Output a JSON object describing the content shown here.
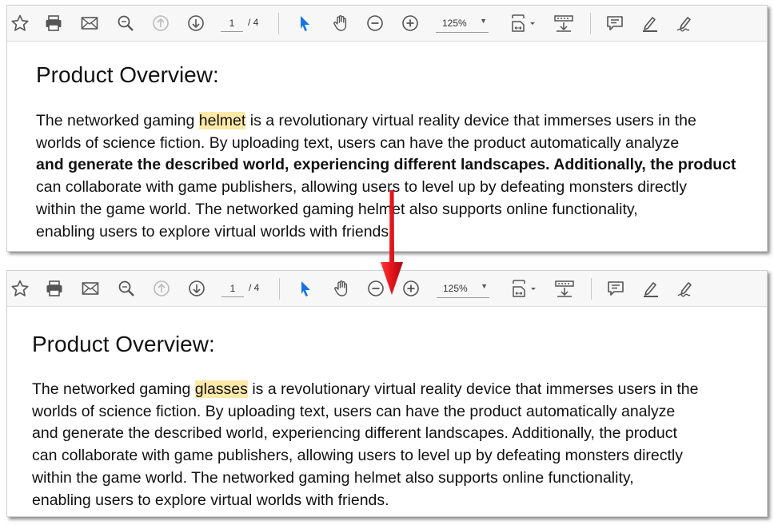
{
  "toolbar": {
    "page_current": "1",
    "page_total": "/ 4",
    "zoom_value": "125%",
    "icons": [
      "star-icon",
      "print-icon",
      "mail-icon",
      "zoom-search-icon",
      "arrow-up-icon",
      "arrow-down-icon",
      "select-cursor-icon",
      "hand-icon",
      "zoom-out-icon",
      "zoom-in-icon",
      "fit-page-icon",
      "scroll-mode-icon",
      "comment-icon",
      "highlight-pen-icon",
      "sign-icon"
    ],
    "accent_color": "#1473e6"
  },
  "document_before": {
    "heading": "Product Overview:",
    "line1_pre": "The networked gaming ",
    "line1_highlight": "helmet",
    "line1_post": " is a revolutionary virtual reality device that immerses users in the",
    "line2": "worlds of science fiction. By uploading text, users can have the product automatically analyze",
    "line3": "and generate the described world, experiencing different landscapes. Additionally, the product",
    "line4": "can collaborate with game publishers, allowing users to level up by defeating monsters directly",
    "line5": "within the game world. The networked gaming helmet also supports online functionality,",
    "line6": "enabling users to explore virtual worlds with friends."
  },
  "document_after": {
    "heading": "Product Overview:",
    "line1_pre": "The networked gaming ",
    "line1_highlight": "glasses",
    "line1_post": " is a revolutionary virtual reality device that immerses users in the",
    "line2": "worlds of science fiction. By uploading text, users can have the product automatically analyze",
    "line3": "and generate the described world, experiencing different landscapes. Additionally, the product",
    "line4": "can collaborate with game publishers, allowing users to level up by defeating monsters directly",
    "line5": "within the game world. The networked gaming helmet also supports online functionality,",
    "line6": "enabling users to explore virtual worlds with friends."
  },
  "highlight_color": "#fde9a8",
  "arrow_color": "#e3141b"
}
